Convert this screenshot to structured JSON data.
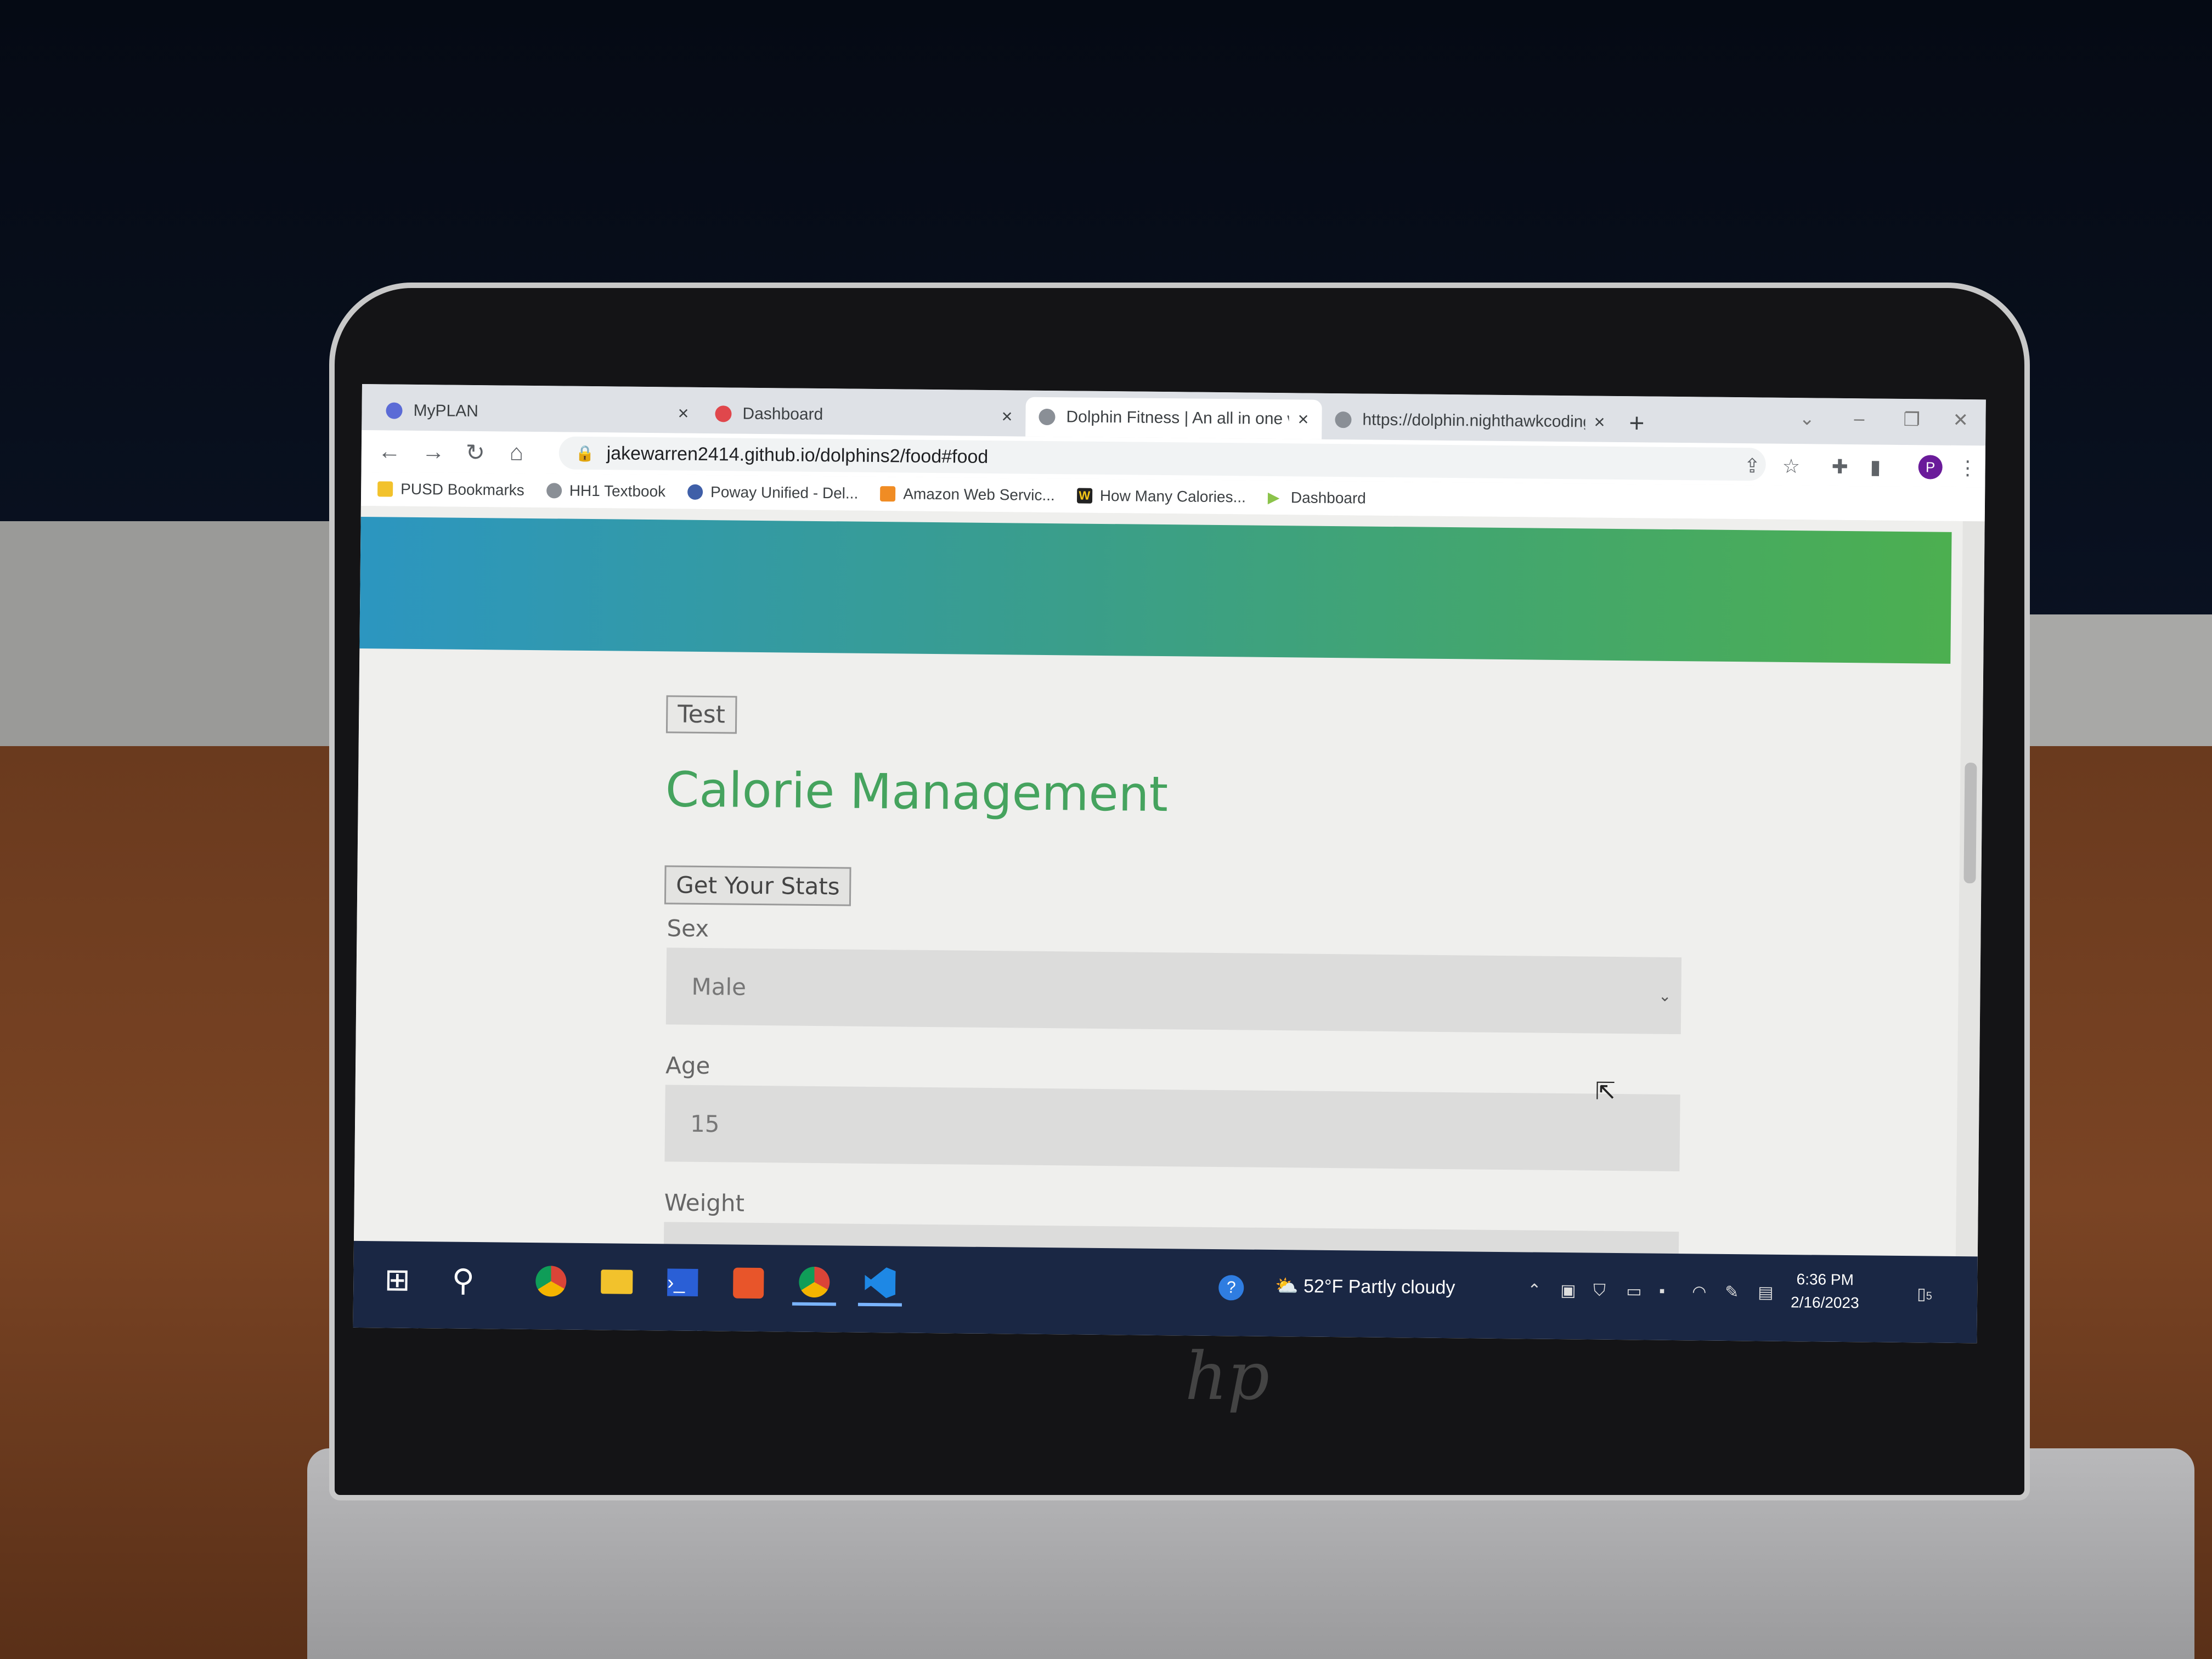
{
  "browser": {
    "tabs": [
      {
        "label": "MyPLAN",
        "favicon": "myplan-icon",
        "active": false
      },
      {
        "label": "Dashboard",
        "favicon": "dashboard-icon",
        "active": false
      },
      {
        "label": "Dolphin Fitness | An all in one we",
        "favicon": "globe-icon",
        "active": true
      },
      {
        "label": "https://dolphin.nighthawkcoding",
        "favicon": "globe-icon",
        "active": false
      }
    ],
    "new_tab": "+",
    "url": "jakewarren2414.github.io/dolphins2/food#food",
    "profile_initial": "P",
    "bookmarks": [
      {
        "label": "PUSD Bookmarks",
        "icon": "folder-icon"
      },
      {
        "label": "HH1 Textbook",
        "icon": "globe-icon"
      },
      {
        "label": "Poway Unified - Del...",
        "icon": "district-icon"
      },
      {
        "label": "Amazon Web Servic...",
        "icon": "aws-icon"
      },
      {
        "label": "How Many Calories...",
        "icon": "w-icon"
      },
      {
        "label": "Dashboard",
        "icon": "play-icon"
      }
    ]
  },
  "page": {
    "test_button": "Test",
    "heading": "Calorie Management",
    "stats_button": "Get Your Stats",
    "fields": {
      "sex": {
        "label": "Sex",
        "value": "Male"
      },
      "age": {
        "label": "Age",
        "value": "15"
      },
      "weight": {
        "label": "Weight"
      }
    },
    "banner_colors": [
      "#2c96c0",
      "#4caf50"
    ],
    "heading_color": "#45a35e"
  },
  "taskbar": {
    "weather": "52°F  Partly cloudy",
    "time": "6:36 PM",
    "date": "2/16/2023",
    "notifications": "5"
  }
}
